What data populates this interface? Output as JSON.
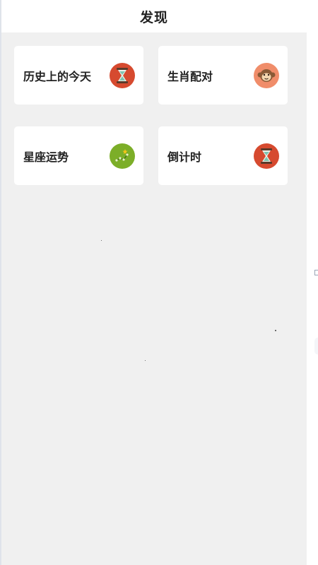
{
  "header": {
    "title": "发现"
  },
  "cards": [
    {
      "label": "历史上的今天",
      "icon": "hourglass-icon"
    },
    {
      "label": "生肖配对",
      "icon": "monkey-icon"
    },
    {
      "label": "星座运势",
      "icon": "constellation-icon"
    },
    {
      "label": "倒计时",
      "icon": "hourglass-icon"
    }
  ],
  "colors": {
    "background": "#f0f0f0",
    "card": "#ffffff",
    "hourglass_bg": "#d64a2f",
    "monkey_bg": "#f08d6a",
    "constellation_bg": "#7cae28"
  }
}
